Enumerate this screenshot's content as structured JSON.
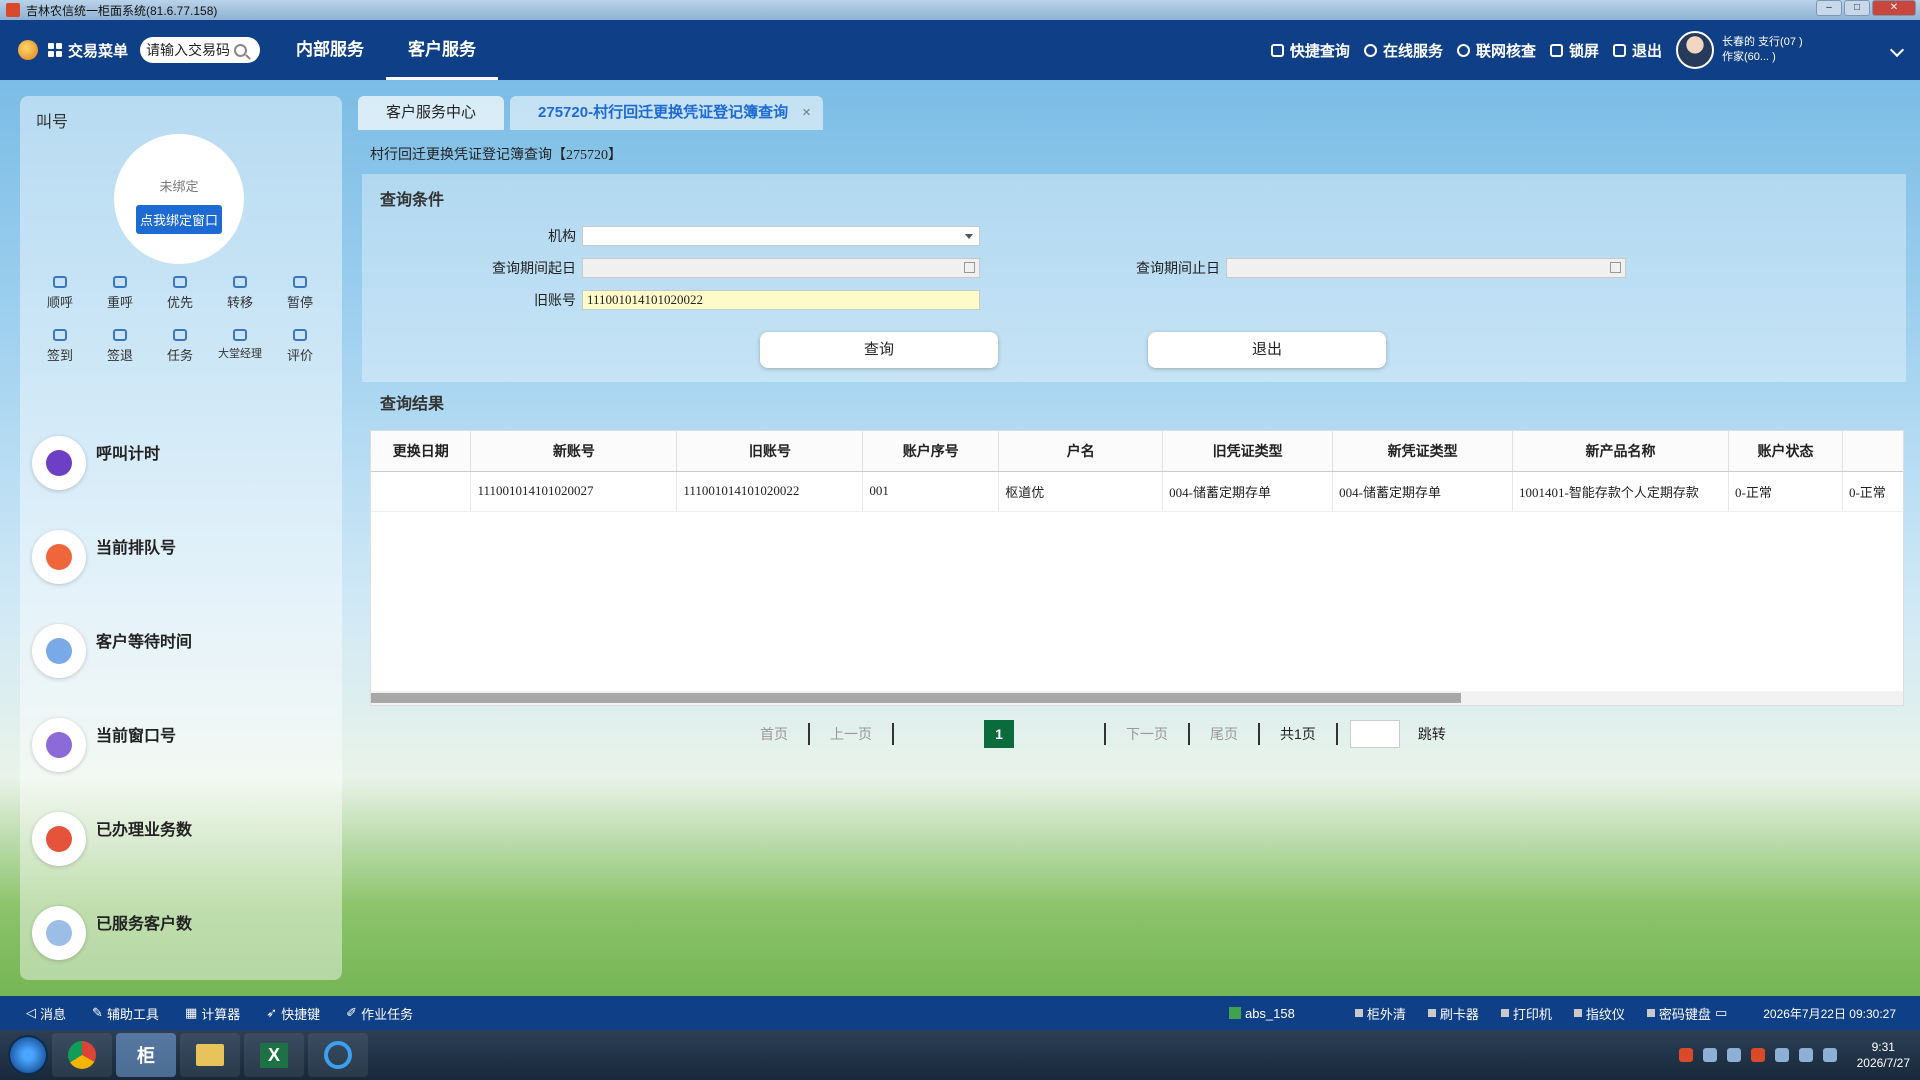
{
  "window": {
    "title": "吉林农信统一柜面系统(81.6.77.158)"
  },
  "topnav": {
    "menu_label": "交易菜单",
    "search_placeholder": "请输入交易码",
    "tabs": [
      "内部服务",
      "客户服务"
    ],
    "right_items": [
      "快捷查询",
      "在线服务",
      "联网核查",
      "锁屏",
      "退出"
    ],
    "user_line1": "长春的          支行(07          )",
    "user_line2": "作家(60...  )"
  },
  "left_panel": {
    "title": "叫号",
    "unbound": "未绑定",
    "bind_button": "点我绑定窗口",
    "tools": [
      "顺呼",
      "重呼",
      "优先",
      "转移",
      "暂停",
      "签到",
      "签退",
      "任务",
      "大堂经理",
      "评价"
    ],
    "stats": [
      "呼叫计时",
      "当前排队号",
      "客户等待时间",
      "当前窗口号",
      "已办理业务数",
      "已服务客户数"
    ]
  },
  "tabs": {
    "home": "客户服务中心",
    "active": "275720-村行回迁更换凭证登记簿查询",
    "close": "×"
  },
  "page_title": "村行回迁更换凭证登记簿查询【275720】",
  "query": {
    "title": "查询条件",
    "org_label": "机构",
    "org_value": "",
    "start_label": "查询期间起日",
    "end_label": "查询期间止日",
    "old_account_label": "旧账号",
    "old_account_value": "111001014101020022",
    "query_button": "查询",
    "exit_button": "退出"
  },
  "results": {
    "title": "查询结果",
    "columns": [
      "更换日期",
      "新账号",
      "旧账号",
      "账户序号",
      "户名",
      "旧凭证类型",
      "新凭证类型",
      "新产品名称",
      "账户状态",
      ""
    ],
    "rows": [
      [
        "",
        "111001014101020027",
        "111001014101020022",
        "001",
        "枢道优",
        "004-储蓄定期存单",
        "004-储蓄定期存单",
        "1001401-智能存款个人定期存款",
        "0-正常",
        "0-正常"
      ]
    ]
  },
  "pager": {
    "first": "首页",
    "prev": "上一页",
    "current": "1",
    "next": "下一页",
    "last": "尾页",
    "total": "共1页",
    "jump": "跳转"
  },
  "statusbar": {
    "left": [
      "消息",
      "辅助工具",
      "计算器",
      "快捷键",
      "作业任务"
    ],
    "terminal": "abs_158",
    "devices": [
      "柜外清",
      "刷卡器",
      "打印机",
      "指纹仪",
      "密码键盘"
    ],
    "datetime": "2026年7月22日 09:30:27"
  },
  "taskbar": {
    "apps": [
      "chrome",
      "柜",
      "files",
      "X",
      "ie"
    ],
    "clock_time": "9:31",
    "clock_date": "2026/7/27"
  }
}
